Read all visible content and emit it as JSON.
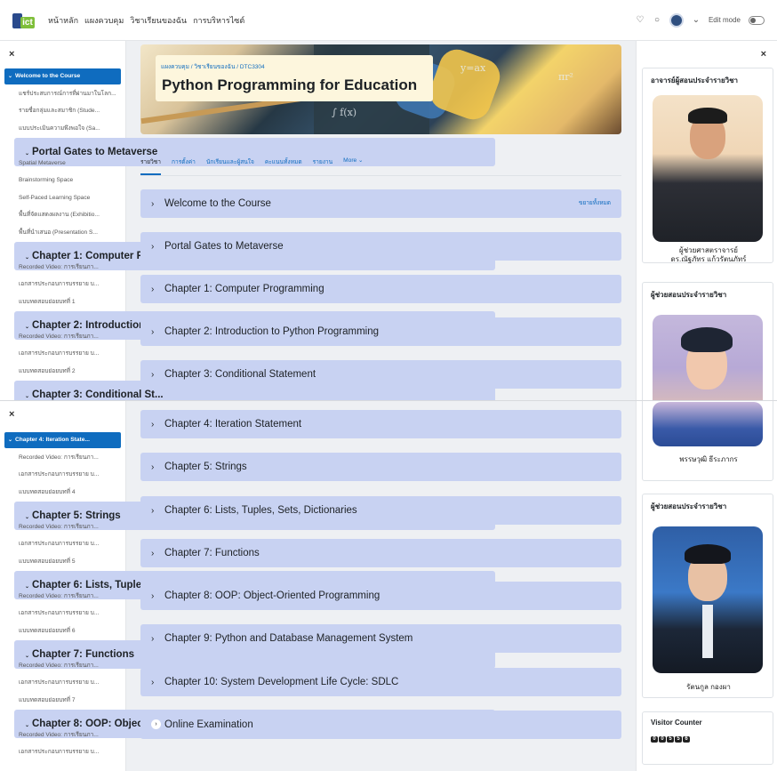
{
  "topbar": {
    "logo": "ict",
    "nav": [
      "หน้าหลัก",
      "แผงควบคุม",
      "วิชาเรียนของฉัน",
      "การบริหารไซต์"
    ],
    "edit_mode": "Edit mode"
  },
  "course": {
    "breadcrumb": "แผงควบคุม / วิชาเรียนของฉัน / DTC3304",
    "title": "Python Programming for Education",
    "tabs": [
      "รายวิชา",
      "การตั้งค่า",
      "นักเรียนและผู้สนใจ",
      "คะแนนทั้งหมด",
      "รายงาน",
      "More ⌄"
    ],
    "expand_all": "ขยายทั้งหมด"
  },
  "sections": [
    "Welcome to the Course",
    "Portal Gates to Metaverse",
    "Chapter 1: Computer Programming",
    "Chapter 2: Introduction to Python Programming",
    "Chapter 3: Conditional Statement",
    "Chapter 4: Iteration Statement",
    "Chapter 5: Strings",
    "Chapter 6: Lists, Tuples, Sets, Dictionaries",
    "Chapter 7: Functions",
    "Chapter 8: OOP: Object-Oriented Programming",
    "Chapter 9: Python and Database Management System",
    "Chapter 10: System Development Life Cycle: SDLC",
    "Online Examination"
  ],
  "sidebar_top": [
    {
      "t": "Welcome to the Course",
      "k": "act"
    },
    {
      "t": "แชร์ประสบการณ์การที่ผ่านมาในโลก...",
      "k": "sub"
    },
    {
      "t": "รายชื่อกลุ่มและสมาชิก (Stude...",
      "k": "sub"
    },
    {
      "t": "แบบประเมินความพึงพอใจ (Sa...",
      "k": "sub"
    },
    {
      "t": "Portal Gates to Metaverse",
      "k": "sec"
    },
    {
      "t": "Spatial Metaverse",
      "k": "sub"
    },
    {
      "t": "Brainstorming Space",
      "k": "sub"
    },
    {
      "t": "Self-Paced Learning Space",
      "k": "sub"
    },
    {
      "t": "พื้นที่จัดแสดงผลงาน (Exhibitio...",
      "k": "sub"
    },
    {
      "t": "พื้นที่นำเสนอ (Presentation S...",
      "k": "sub"
    },
    {
      "t": "Chapter 1: Computer Pro...",
      "k": "sec"
    },
    {
      "t": "Recorded Video: การเรียนภา...",
      "k": "sub"
    },
    {
      "t": "เอกสารประกอบการบรรยาย บ...",
      "k": "sub"
    },
    {
      "t": "แบบทดสอบย่อยบทที่ 1",
      "k": "sub"
    },
    {
      "t": "Chapter 2: Introduction t...",
      "k": "sec"
    },
    {
      "t": "Recorded Video: การเรียนภา...",
      "k": "sub"
    },
    {
      "t": "เอกสารประกอบการบรรยาย บ...",
      "k": "sub"
    },
    {
      "t": "แบบทดสอบย่อยบทที่ 2",
      "k": "sub"
    },
    {
      "t": "Chapter 3: Conditional St...",
      "k": "sec"
    }
  ],
  "sidebar_bottom": [
    {
      "t": "Chapter 4: Iteration State...",
      "k": "act"
    },
    {
      "t": "Recorded Video: การเรียนภา...",
      "k": "sub"
    },
    {
      "t": "เอกสารประกอบการบรรยาย บ...",
      "k": "sub"
    },
    {
      "t": "แบบทดสอบย่อยบทที่ 4",
      "k": "sub"
    },
    {
      "t": "Chapter 5: Strings",
      "k": "sec"
    },
    {
      "t": "Recorded Video: การเรียนภา...",
      "k": "sub"
    },
    {
      "t": "เอกสารประกอบการบรรยาย บ...",
      "k": "sub"
    },
    {
      "t": "แบบทดสอบย่อยบทที่ 5",
      "k": "sub"
    },
    {
      "t": "Chapter 6: Lists, Tuples, ...",
      "k": "sec"
    },
    {
      "t": "Recorded Video: การเรียนภา...",
      "k": "sub"
    },
    {
      "t": "เอกสารประกอบการบรรยาย บ...",
      "k": "sub"
    },
    {
      "t": "แบบทดสอบย่อยบทที่ 6",
      "k": "sub"
    },
    {
      "t": "Chapter 7: Functions",
      "k": "sec"
    },
    {
      "t": "Recorded Video: การเรียนภา...",
      "k": "sub"
    },
    {
      "t": "เอกสารประกอบการบรรยาย บ...",
      "k": "sub"
    },
    {
      "t": "แบบทดสอบย่อยบทที่ 7",
      "k": "sub"
    },
    {
      "t": "Chapter 8: OOP: Object-...",
      "k": "sec"
    },
    {
      "t": "Recorded Video: การเรียนภา...",
      "k": "sub"
    },
    {
      "t": "เอกสารประกอบการบรรยาย บ...",
      "k": "sub"
    }
  ],
  "right": {
    "lecturer_heading": "อาจารย์ผู้สอนประจำรายวิชา",
    "lecturer_name1": "ผู้ช่วยศาสตราจารย์",
    "lecturer_name2": "ดร.ณัฐภัทร แก้วรัตนภัทร์",
    "ta_heading": "ผู้ช่วยสอนประจำรายวิชา",
    "ta1_name": "พรรษวุฒิ ธีระภากร",
    "ta2_name": "รัตนกูล กองผา",
    "counter_heading": "Visitor Counter",
    "counter_digits": [
      "0",
      "0",
      "5",
      "5",
      "6"
    ]
  }
}
